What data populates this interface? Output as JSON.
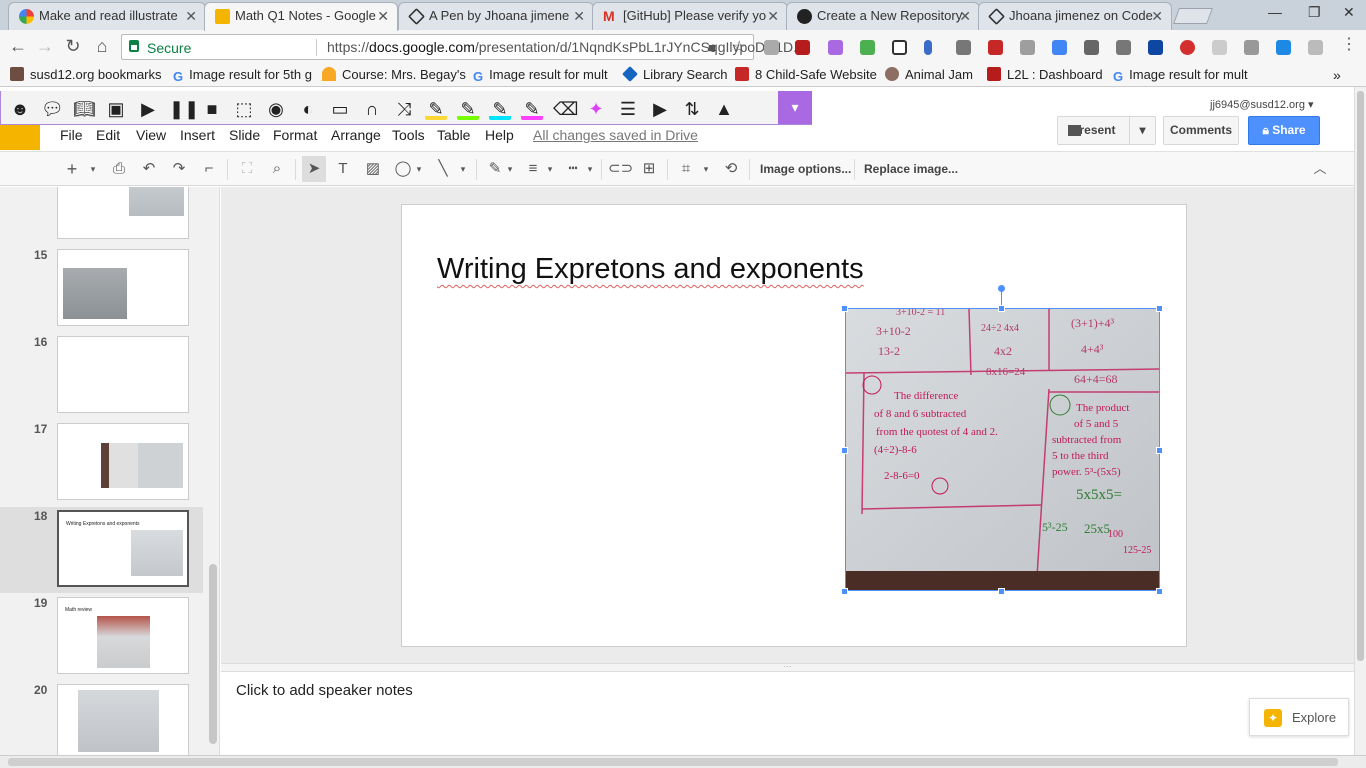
{
  "browser": {
    "tabs": [
      {
        "title": "Make and read illustrate",
        "favicon": "slides-grid-icon"
      },
      {
        "title": "Math Q1 Notes - Google",
        "favicon": "google-slides-icon",
        "active": true
      },
      {
        "title": "A Pen by Jhoana jimene",
        "favicon": "codepen-icon"
      },
      {
        "title": "[GitHub] Please verify yo",
        "favicon": "gmail-icon"
      },
      {
        "title": "Create a New Repository",
        "favicon": "github-icon"
      },
      {
        "title": "Jhoana jimenez on Code",
        "favicon": "codepen-icon"
      }
    ],
    "secure_label": "Secure",
    "url_prefix": "https://",
    "url_host": "docs.google.com",
    "url_path": "/presentation/d/1NqndKsPbL1rJYnCSqgIlypoDcl1D...",
    "bookmarks": [
      "susd12.org bookmarks",
      "Image result for 5th g",
      "Course: Mrs. Begay's",
      "Image result for mult",
      "Library Search",
      "8 Child-Safe Website",
      "Animal Jam",
      "L2L : Dashboard",
      "Image result for mult"
    ]
  },
  "app": {
    "menus": [
      "File",
      "Edit",
      "View",
      "Insert",
      "Slide",
      "Format",
      "Arrange",
      "Tools",
      "Table",
      "Help"
    ],
    "save_status": "All changes saved in Drive",
    "account": "jj6945@susd12.org",
    "present_label": "Present",
    "comments_label": "Comments",
    "share_label": "Share",
    "image_options_label": "Image options...",
    "replace_image_label": "Replace image..."
  },
  "filmstrip": {
    "slides": [
      {
        "number": "15",
        "title": ""
      },
      {
        "number": "16",
        "title": ""
      },
      {
        "number": "17",
        "title": ""
      },
      {
        "number": "18",
        "title": "Writing Expretons and exponents"
      },
      {
        "number": "19",
        "title": "Math review"
      },
      {
        "number": "20",
        "title": ""
      }
    ]
  },
  "slide": {
    "title": "Writing Expretons and exponents",
    "photo_text": {
      "cell1": "3+10-2",
      "cell2": "13-2",
      "cell3": "24÷2 4x4",
      "cell4": "4x2",
      "cell5": "8x16=24",
      "cell6": "(3+1)+4³",
      "cell7": "4+4³",
      "cell8": "64+4=68",
      "cell9": "The difference of 8 and 6 subtracted from the quotest of 4 and 2.",
      "cell10": "(4÷2)-8-6",
      "cell11": "2-8-6=0",
      "cell12": "The product of 5 and 5 subtracted from 5 to the third power. 5³-(5x5)",
      "cell13": "5x5x5=",
      "cell14": "5³-25",
      "cell15": "25x5",
      "cell16": "125-25",
      "cell17": "100"
    }
  },
  "notes": {
    "placeholder": "Click to add speaker notes"
  },
  "explore_label": "Explore"
}
